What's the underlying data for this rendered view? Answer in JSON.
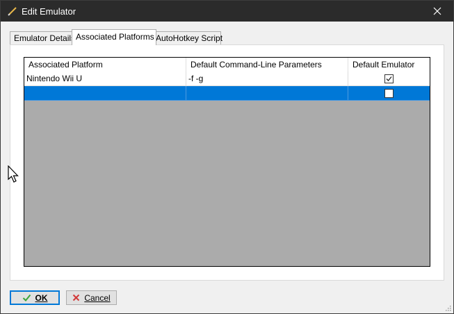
{
  "window": {
    "title": "Edit Emulator"
  },
  "tabs": [
    {
      "label": "Emulator Details",
      "active": false
    },
    {
      "label": "Associated Platforms",
      "active": true
    },
    {
      "label": "AutoHotkey Script",
      "active": false
    }
  ],
  "grid": {
    "columns": [
      "Associated Platform",
      "Default Command-Line Parameters",
      "Default Emulator"
    ],
    "rows": [
      {
        "platform": "Nintendo Wii U",
        "params": "-f -g",
        "default": true
      },
      {
        "platform": "",
        "params": "",
        "default": false,
        "selected": true
      }
    ]
  },
  "buttons": {
    "ok": "OK",
    "cancel": "Cancel"
  },
  "colors": {
    "selection": "#0078d7",
    "grid_background": "#ababab",
    "titlebar": "#2b2b2b"
  }
}
